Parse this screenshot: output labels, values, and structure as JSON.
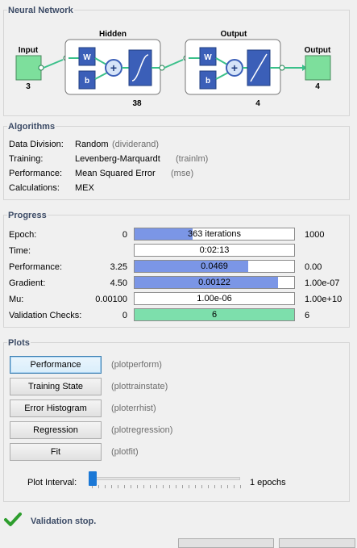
{
  "network": {
    "title": "Neural Network",
    "input_label": "Input",
    "input_size": "3",
    "hidden_label": "Hidden",
    "hidden_size": "38",
    "output_layer_label": "Output",
    "output_layer_size": "4",
    "output_label": "Output",
    "output_size": "4",
    "weight_symbol": "W",
    "bias_symbol": "b",
    "sum_symbol": "+"
  },
  "algorithms": {
    "title": "Algorithms",
    "rows": [
      {
        "label": "Data Division:",
        "value": "Random",
        "func": "(dividerand)"
      },
      {
        "label": "Training:",
        "value": "Levenberg-Marquardt",
        "func": "(trainlm)"
      },
      {
        "label": "Performance:",
        "value": "Mean Squared Error",
        "func": "(mse)"
      },
      {
        "label": "Calculations:",
        "value": "MEX",
        "func": ""
      }
    ]
  },
  "progress": {
    "title": "Progress",
    "rows": [
      {
        "label": "Epoch:",
        "start": "0",
        "current": "363 iterations",
        "end": "1000",
        "fraction": 0.363,
        "color": "blue"
      },
      {
        "label": "Time:",
        "start": "",
        "current": "0:02:13",
        "end": "",
        "fraction": 0,
        "color": "blue"
      },
      {
        "label": "Performance:",
        "start": "3.25",
        "current": "0.0469",
        "end": "0.00",
        "fraction": 0.71,
        "color": "blue"
      },
      {
        "label": "Gradient:",
        "start": "4.50",
        "current": "0.00122",
        "end": "1.00e-07",
        "fraction": 0.9,
        "color": "blue"
      },
      {
        "label": "Mu:",
        "start": "0.00100",
        "current": "1.00e-06",
        "end": "1.00e+10",
        "fraction": 0,
        "color": "blue"
      },
      {
        "label": "Validation Checks:",
        "start": "0",
        "current": "6",
        "end": "6",
        "fraction": 1.0,
        "color": "green"
      }
    ]
  },
  "plots": {
    "title": "Plots",
    "buttons": [
      {
        "label": "Performance",
        "func": "(plotperform)"
      },
      {
        "label": "Training State",
        "func": "(plottrainstate)"
      },
      {
        "label": "Error Histogram",
        "func": "(ploterrhist)"
      },
      {
        "label": "Regression",
        "func": "(plotregression)"
      },
      {
        "label": "Fit",
        "func": "(plotfit)"
      }
    ],
    "interval_label": "Plot Interval:",
    "interval_value": "1 epochs",
    "interval_fraction": 0.0
  },
  "status": {
    "message": "Validation stop.",
    "icon": "checkmark-icon",
    "color": "#2e9e2e"
  },
  "colors": {
    "bar_fill": "#7b96e6",
    "bar_fill_green": "#7ddfac",
    "input_box": "#7ddf9c",
    "block_blue": "#3b5fb8"
  }
}
